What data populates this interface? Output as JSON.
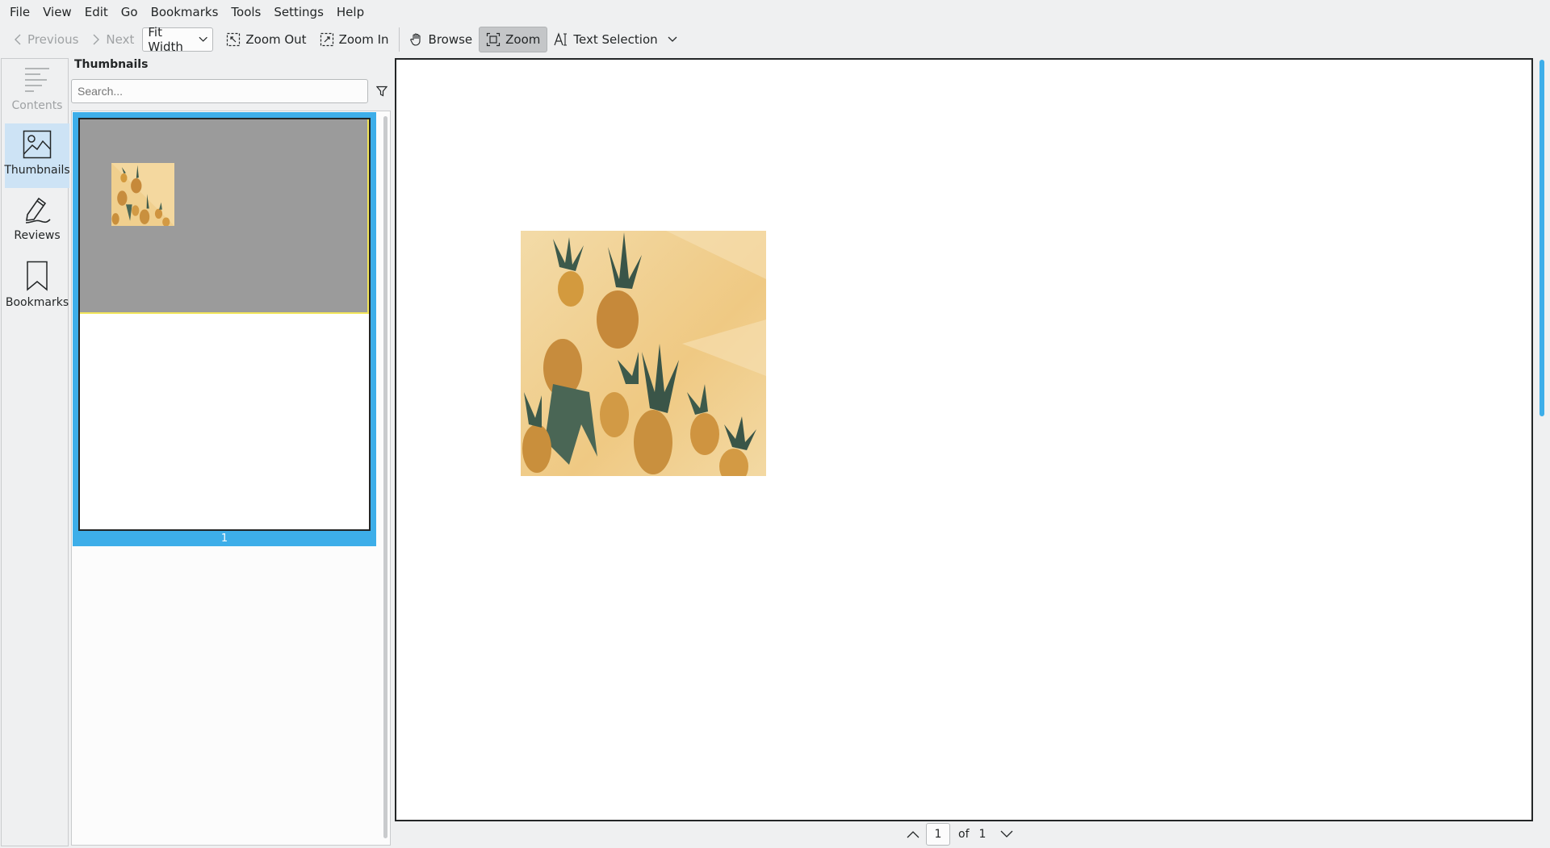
{
  "menubar": {
    "items": [
      "File",
      "View",
      "Edit",
      "Go",
      "Bookmarks",
      "Tools",
      "Settings",
      "Help"
    ]
  },
  "toolbar": {
    "previous_label": "Previous",
    "next_label": "Next",
    "zoom_mode": "Fit Width",
    "zoom_out_label": "Zoom Out",
    "zoom_in_label": "Zoom In",
    "browse_label": "Browse",
    "zoom_label": "Zoom",
    "text_selection_label": "Text Selection"
  },
  "sidebar": {
    "tabs": [
      {
        "label": "Contents",
        "icon": "contents-icon",
        "state": "disabled"
      },
      {
        "label": "Thumbnails",
        "icon": "thumbnails-icon",
        "state": "selected"
      },
      {
        "label": "Reviews",
        "icon": "reviews-icon",
        "state": "normal"
      },
      {
        "label": "Bookmarks",
        "icon": "bookmarks-icon",
        "state": "normal"
      }
    ]
  },
  "thumbnails_panel": {
    "title": "Thumbnails",
    "search_placeholder": "Search...",
    "pages": [
      {
        "number": "1"
      }
    ]
  },
  "page_nav": {
    "current_page": "1",
    "of_label": "of",
    "total_pages": "1"
  },
  "colors": {
    "accent": "#3daee9",
    "window_bg": "#eff0f1",
    "visible_area_overlay": "#9b9b9b",
    "visible_area_border": "#f2e55a"
  }
}
